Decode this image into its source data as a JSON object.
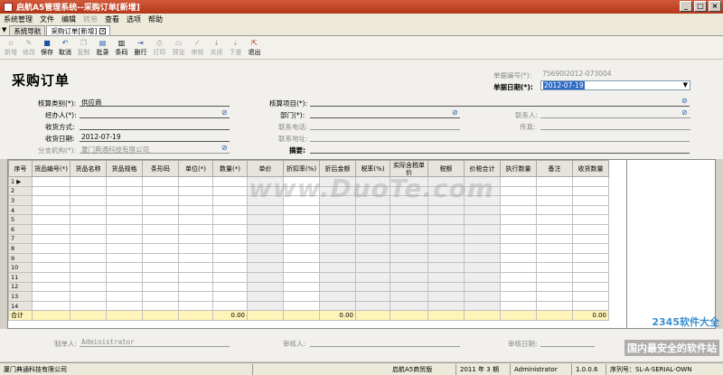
{
  "window": {
    "title": "启航A5管理系统--采购订单[新增]"
  },
  "menu": [
    "系统管理",
    "文件",
    "编辑",
    "转单",
    "查看",
    "选项",
    "帮助"
  ],
  "tabs": [
    {
      "label": "系统导航"
    },
    {
      "label": "采购订单[新增]"
    }
  ],
  "toolbar": [
    {
      "label": "新增",
      "icon": "new-icon",
      "enabled": false
    },
    {
      "label": "修改",
      "icon": "edit-icon",
      "enabled": false
    },
    {
      "label": "保存",
      "icon": "save-icon",
      "enabled": true
    },
    {
      "label": "取消",
      "icon": "undo-icon",
      "enabled": true
    },
    {
      "label": "复制",
      "icon": "copy-icon",
      "enabled": false
    },
    {
      "label": "批录",
      "icon": "batch-icon",
      "enabled": true
    },
    {
      "label": "条码",
      "icon": "barcode-icon",
      "enabled": true
    },
    {
      "label": "删行",
      "icon": "delete-row-icon",
      "enabled": true
    },
    {
      "label": "打印",
      "icon": "print-icon",
      "enabled": false
    },
    {
      "label": "预览",
      "icon": "preview-icon",
      "enabled": false
    },
    {
      "label": "审核",
      "icon": "check-icon",
      "enabled": false
    },
    {
      "label": "关闭",
      "icon": "close-doc-icon",
      "enabled": false
    },
    {
      "label": "下查",
      "icon": "down-query-icon",
      "enabled": false
    },
    {
      "label": "退出",
      "icon": "exit-icon",
      "enabled": true
    }
  ],
  "form": {
    "title": "采购订单",
    "doc_no_label": "单据编号(*):",
    "doc_no_value": "75690I2012-073004",
    "doc_date_label": "单据日期(*):",
    "doc_date_value": "2012-07-19",
    "category_label": "核算类别(*):",
    "category_value": "供应商",
    "item_label": "核算项目(*):",
    "handler_label": "经办人(*):",
    "dept_label": "部门(*):",
    "contact_label": "联系人:",
    "receive_method_label": "收货方式:",
    "phone_label": "联系电话:",
    "fax_label": "传真:",
    "receive_date_label": "收货日期:",
    "receive_date_value": "2012-07-19",
    "address_label": "联系地址:",
    "branch_label": "分支机构(*):",
    "branch_value": "厦门典通科技有限公司",
    "summary_label": "摘要:"
  },
  "grid": {
    "columns": [
      "序号",
      "货品编号(*)",
      "货品名称",
      "货品规格",
      "条形码",
      "单位(*)",
      "数量(*)",
      "单价",
      "折扣率(%)",
      "折后金额",
      "税率(%)",
      "实际含税单价",
      "税额",
      "价税合计",
      "执行数量",
      "备注",
      "收货数量"
    ],
    "rows": [
      "1",
      "2",
      "3",
      "4",
      "5",
      "6",
      "7",
      "8",
      "9",
      "10",
      "11",
      "12",
      "13",
      "14"
    ],
    "total_label": "合计",
    "total_qty": "0.00",
    "total_amount": "0.00",
    "total_receive": "0.00"
  },
  "footer": {
    "maker_label": "制单人:",
    "maker_value": "Administrator",
    "auditor_label": "审核人:",
    "audit_date_label": "审核日期:"
  },
  "status": {
    "company": "厦门典通科技有限公司",
    "product": "启航A5商贸版",
    "period": "2011 年 3 期",
    "user": "Administrator",
    "version": "1.0.0.6",
    "serial": "序列号：SL-A-SERIAL-OWN"
  },
  "watermarks": {
    "duote": "www.DuoTe.com",
    "logo": "2345软件大全",
    "logo_sub": "国内最安全的软件站"
  }
}
